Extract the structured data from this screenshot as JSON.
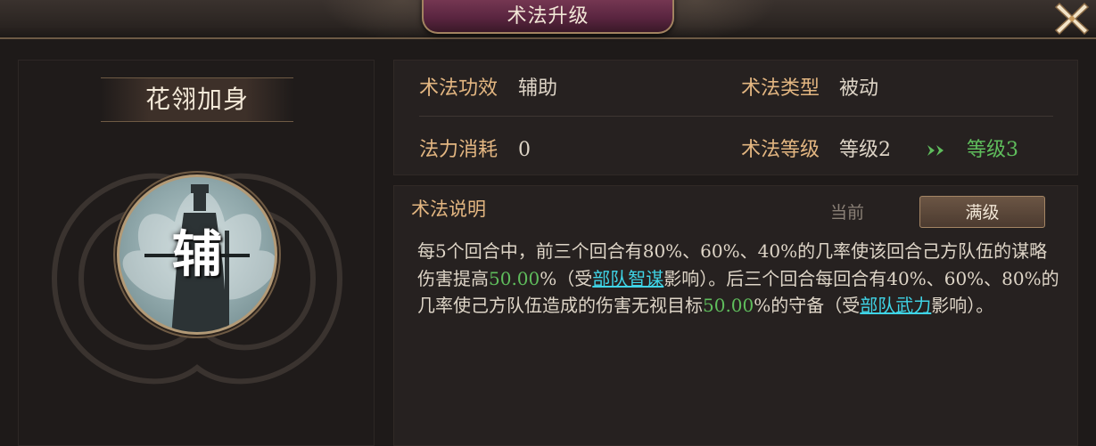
{
  "header": {
    "title": "术法升级"
  },
  "skill": {
    "name": "花翎加身",
    "icon_char": "辅"
  },
  "info": {
    "effect_label": "术法功效",
    "effect_value": "辅助",
    "type_label": "术法类型",
    "type_value": "被动",
    "cost_label": "法力消耗",
    "cost_value": "0",
    "level_label": "术法等级",
    "level_current": "等级2",
    "level_next": "等级3"
  },
  "description": {
    "heading": "术法说明",
    "tabs": [
      {
        "label": "当前"
      },
      {
        "label": "满级"
      }
    ],
    "selected_tab": "满级",
    "segments": [
      {
        "text": "每5个回合中，前三个回合有80%、60%、40%的几率使该回合己方队伍的谋略伤害提高",
        "style": "plain"
      },
      {
        "text": "50.00",
        "style": "num"
      },
      {
        "text": "%（受",
        "style": "plain"
      },
      {
        "text": "部队智谋",
        "style": "link"
      },
      {
        "text": "影响）。后三个回合每回合有40%、60%、80%的几率使己方队伍造成的伤害无视目标",
        "style": "plain"
      },
      {
        "text": "50.00",
        "style": "num"
      },
      {
        "text": "%的守备（受",
        "style": "plain"
      },
      {
        "text": "部队武力",
        "style": "link"
      },
      {
        "text": "影响）。",
        "style": "plain"
      }
    ]
  },
  "colors": {
    "label": "#e3b681",
    "highlight_green": "#5fbd5c",
    "link_cyan": "#3fd4e6",
    "title_plate": "#5a2540"
  },
  "icons": {
    "close": "close-x-icon",
    "arrow": "double-chevron-right-icon"
  }
}
